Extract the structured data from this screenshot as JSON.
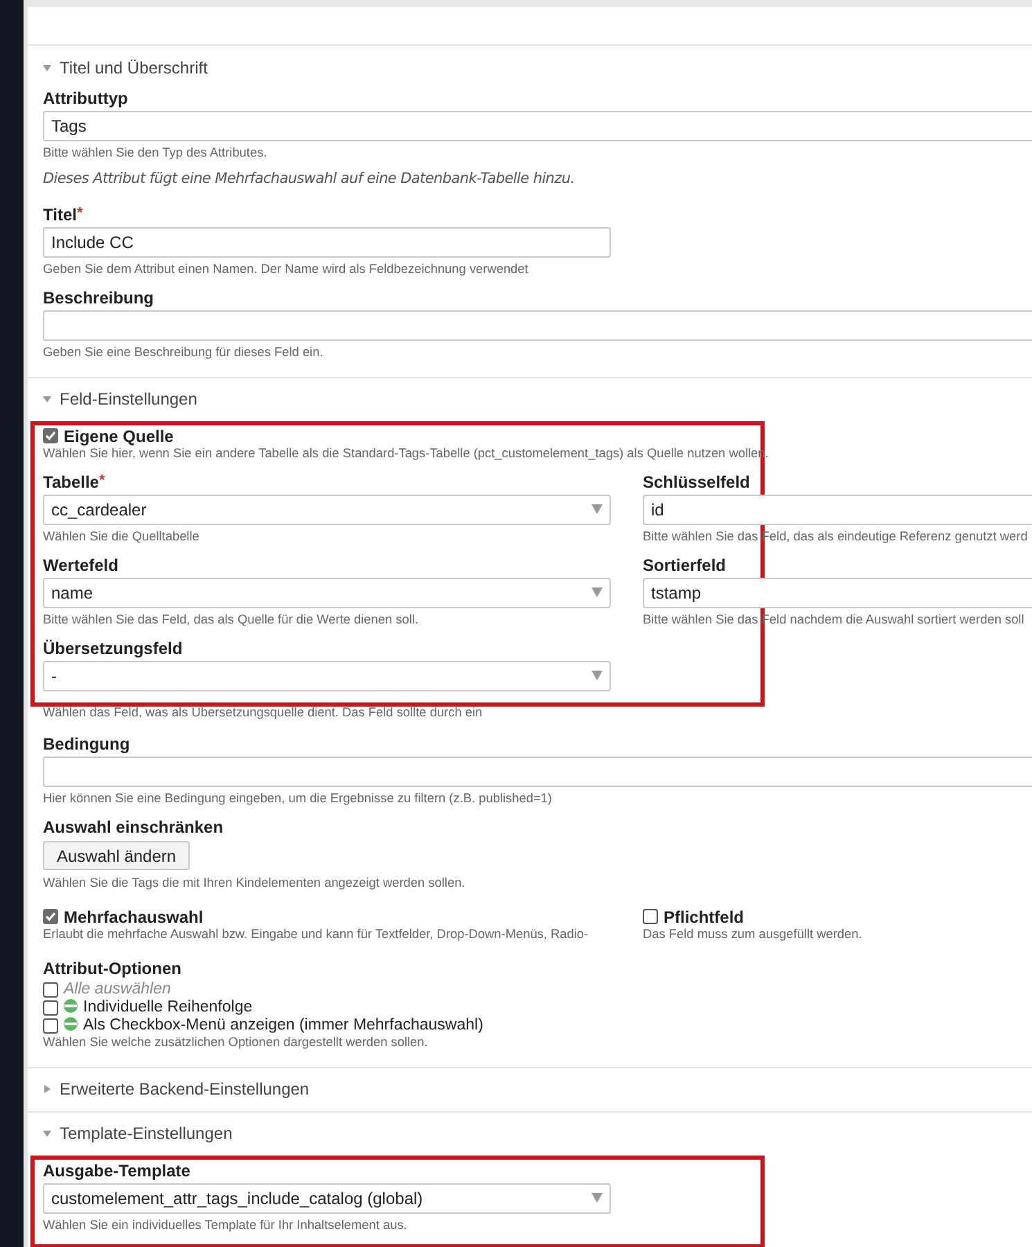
{
  "sections": [
    {
      "legend": "Titel und Überschrift",
      "expanded": true,
      "blocks": [
        {
          "rows": [
            [
              {
                "kind": "input",
                "label": "Attributtyp",
                "value": "Tags",
                "full": true,
                "hint": "Bitte wählen Sie den Typ des Attributes."
              }
            ],
            [
              {
                "kind": "note",
                "text": "Dieses Attribut fügt eine Mehrfachauswahl auf eine Datenbank-Tabelle hinzu."
              }
            ],
            [
              {
                "kind": "input",
                "label": "Titel",
                "required_mark": "*",
                "value": "Include CC",
                "full": false,
                "hint": "Geben Sie dem Attribut einen Namen. Der Name wird als Feldbezeichnung verwendet"
              }
            ],
            [
              {
                "kind": "input",
                "label": "Beschreibung",
                "full": true,
                "hint": "Geben Sie eine Beschreibung für dieses Feld ein."
              }
            ]
          ]
        }
      ]
    },
    {
      "legend": "Feld-Einstellungen",
      "expanded": true,
      "blocks": [
        {
          "highlighted": true,
          "rows": [
            [
              {
                "kind": "checkbox",
                "label": "Eigene Quelle",
                "checked": true,
                "hint": "Wählen Sie hier, wenn Sie ein andere Tabelle als die Standard-Tags-Tabelle (pct_customelement_tags) als Quelle nutzen wollen."
              }
            ],
            [
              {
                "kind": "select",
                "label": "Tabelle",
                "required_mark": "*",
                "value": "cc_cardealer",
                "hint": "Wählen Sie die Quelltabelle"
              },
              {
                "kind": "input",
                "label": "Schlüsselfeld",
                "value": "id",
                "hint": "Bitte wählen Sie das Feld, das als eindeutige Referenz genutzt werd"
              }
            ],
            [
              {
                "kind": "select",
                "label": "Wertefeld",
                "value": "name",
                "hint": "Bitte wählen Sie das Feld, das als Quelle für die Werte dienen soll."
              },
              {
                "kind": "input",
                "label": "Sortierfeld",
                "value": "tstamp",
                "hint": "Bitte wählen Sie das Feld nachdem die Auswahl sortiert werden soll"
              }
            ],
            [
              {
                "kind": "select",
                "label": "Übersetzungsfeld",
                "value": "-",
                "full": false
              }
            ]
          ]
        },
        {
          "rows": [
            [
              {
                "kind": "hint",
                "text": "Wählen das Feld, was als Übersetzungsquelle dient. Das Feld sollte durch ein"
              }
            ],
            [
              {
                "kind": "input",
                "label": "Bedingung",
                "full": true,
                "hint": "Hier können Sie eine Bedingung eingeben, um die Ergebnisse zu filtern (z.B. published=1)"
              }
            ],
            [
              {
                "kind": "button",
                "label": "Auswahl einschränken",
                "button": "Auswahl ändern",
                "hint": "Wählen Sie die Tags die mit Ihren Kindelementen angezeigt werden sollen."
              }
            ],
            [
              {
                "kind": "checkbox",
                "label": "Mehrfachauswahl",
                "checked": true,
                "hint": "Erlaubt die mehrfache Auswahl bzw. Eingabe und kann für Textfelder, Drop-Down-Menüs, Radio-"
              },
              {
                "kind": "checkbox",
                "label": "Pflichtfeld",
                "checked": false,
                "hint": "Das Feld muss zum ausgefüllt werden."
              }
            ],
            [
              {
                "kind": "options",
                "label": "Attribut-Optionen",
                "options": [
                  {
                    "kind": "select_all",
                    "label": "Alle auswählen",
                    "checked": false
                  },
                  {
                    "kind": "flagged",
                    "label": "Individuelle Reihenfolge",
                    "checked": false
                  },
                  {
                    "kind": "flagged",
                    "label": "Als Checkbox-Menü anzeigen (immer Mehrfachauswahl)",
                    "checked": false
                  }
                ],
                "hint": "Wählen Sie welche zusätzlichen Optionen dargestellt werden sollen."
              }
            ]
          ]
        }
      ]
    },
    {
      "legend": "Erweiterte Backend-Einstellungen",
      "expanded": false
    },
    {
      "legend": "Template-Einstellungen",
      "expanded": true,
      "blocks": [
        {
          "highlighted": true,
          "rows": [
            [
              {
                "kind": "select",
                "label": "Ausgabe-Template",
                "value": "customelement_attr_tags_include_catalog (global)",
                "full": false,
                "hint": "Wählen Sie ein individuelles Template für Ihr Inhaltselement aus."
              }
            ]
          ]
        }
      ]
    }
  ]
}
